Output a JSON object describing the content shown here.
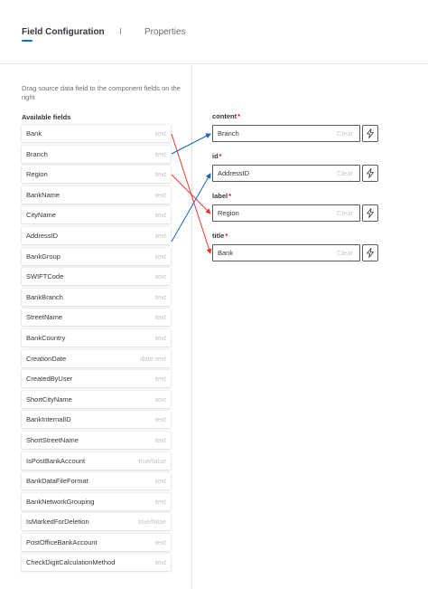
{
  "tabs": {
    "active_label": "Field Configuration",
    "inactive_label": "Properties"
  },
  "hint": "Drag source data field to the component fields on the right",
  "available_title": "Available fields",
  "fields": [
    {
      "name": "Bank",
      "type": "text"
    },
    {
      "name": "Branch",
      "type": "text"
    },
    {
      "name": "Region",
      "type": "text"
    },
    {
      "name": "BankName",
      "type": "text"
    },
    {
      "name": "CityName",
      "type": "text"
    },
    {
      "name": "AddressID",
      "type": "text"
    },
    {
      "name": "BankGroup",
      "type": "text"
    },
    {
      "name": "SWIFTCode",
      "type": "text"
    },
    {
      "name": "BankBranch",
      "type": "text"
    },
    {
      "name": "StreetName",
      "type": "text"
    },
    {
      "name": "BankCountry",
      "type": "text"
    },
    {
      "name": "CreationDate",
      "type": "date text"
    },
    {
      "name": "CreatedByUser",
      "type": "text"
    },
    {
      "name": "ShortCityName",
      "type": "text"
    },
    {
      "name": "BankInternalID",
      "type": "text"
    },
    {
      "name": "ShortStreetName",
      "type": "text"
    },
    {
      "name": "IsPostBankAccount",
      "type": "true/false"
    },
    {
      "name": "BankDataFileFormat",
      "type": "text"
    },
    {
      "name": "BankNetworkGrouping",
      "type": "text"
    },
    {
      "name": "IsMarkedForDeletion",
      "type": "true/false"
    },
    {
      "name": "PostOfficeBankAccount",
      "type": "text"
    },
    {
      "name": "CheckDigitCalculationMethod",
      "type": "text"
    }
  ],
  "targets": [
    {
      "label": "content",
      "required": "*",
      "value": "Branch",
      "clear": "Clear"
    },
    {
      "label": "id",
      "required": "*",
      "value": "AddressID",
      "clear": "Clear"
    },
    {
      "label": "label",
      "required": "*",
      "value": "Region",
      "clear": "Clear"
    },
    {
      "label": "title",
      "required": "*",
      "value": "Bank",
      "clear": "Clear"
    }
  ],
  "icons": {
    "action_button": "lightning-bolt-icon"
  },
  "colors": {
    "accent": "#0a6ed1",
    "arrow_blue": "#1565c0",
    "arrow_red": "#e53935",
    "required": "#ee0000"
  }
}
